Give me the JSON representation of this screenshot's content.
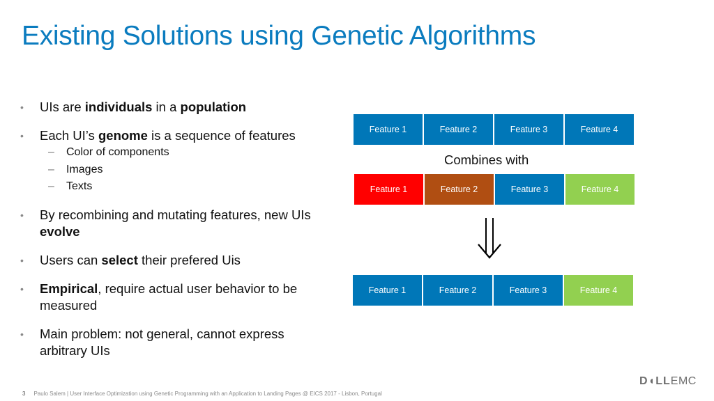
{
  "slide": {
    "title": "Existing Solutions using Genetic Algorithms",
    "bullets": [
      {
        "parts": [
          "UIs are ",
          "individuals",
          " in a ",
          "population"
        ]
      },
      {
        "parts": [
          "Each UI’s ",
          "genome",
          " is a sequence of features"
        ],
        "subitems": [
          "Color of components",
          "Images",
          "Texts"
        ]
      },
      {
        "parts": [
          "By recombining and mutating features, new UIs ",
          "evolve"
        ]
      },
      {
        "parts": [
          "Users can ",
          "select",
          " their prefered Uis"
        ]
      },
      {
        "parts": [
          "Empirical",
          ", require actual user behavior to be measured"
        ]
      },
      {
        "parts": [
          "Main problem: not general, cannot express arbitrary UIs"
        ]
      }
    ],
    "bullet_glyph": "•",
    "dash_glyph": "–"
  },
  "diagram": {
    "parent_a": [
      {
        "label": "Feature 1",
        "color": "#0077b8"
      },
      {
        "label": "Feature 2",
        "color": "#0077b8"
      },
      {
        "label": "Feature 3",
        "color": "#0077b8"
      },
      {
        "label": "Feature 4",
        "color": "#0077b8"
      }
    ],
    "combines_label": "Combines with",
    "parent_b": [
      {
        "label": "Feature 1",
        "color": "#ff0000"
      },
      {
        "label": "Feature 2",
        "color": "#b04e12"
      },
      {
        "label": "Feature 3",
        "color": "#0077b8"
      },
      {
        "label": "Feature 4",
        "color": "#92d050"
      }
    ],
    "arrow_icon": "double-down-arrow",
    "child": [
      {
        "label": "Feature 1",
        "color": "#0077b8"
      },
      {
        "label": "Feature 2",
        "color": "#0077b8"
      },
      {
        "label": "Feature 3",
        "color": "#0077b8"
      },
      {
        "label": "Feature 4",
        "color": "#92d050"
      }
    ]
  },
  "footer": {
    "page_number": "3",
    "text": "Paulo Salem | User Interface Optimization using Genetic Programming with an Application to Landing Pages  @  EICS 2017 - Lisbon, Portugal"
  },
  "logo": {
    "dell": "D◖LL",
    "emc": "EMC"
  }
}
